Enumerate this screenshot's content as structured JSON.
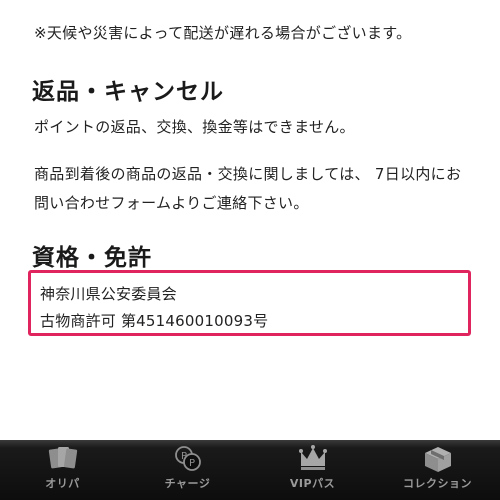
{
  "shipping_note": "※天候や災害によって配送が遅れる場合がございます。",
  "returns": {
    "heading": "返品・キャンセル",
    "paragraph1": "ポイントの返品、交換、換金等はできません。",
    "paragraph2": "商品到着後の商品の返品・交換に関しましては、 7日以内にお問い合わせフォームよりご連絡下さい。"
  },
  "license": {
    "heading": "資格・免許",
    "line1": "神奈川県公安委員会",
    "line2": "古物商許可 第451460010093号",
    "highlight_color": "#e0245e"
  },
  "bottom_nav": {
    "items": [
      {
        "label": "オリパ",
        "icon": "cards-icon"
      },
      {
        "label": "チャージ",
        "icon": "points-icon"
      },
      {
        "label": "VIPパス",
        "icon": "crown-icon"
      },
      {
        "label": "コレクション",
        "icon": "box-icon"
      }
    ],
    "text_color": "#9a9a9a"
  }
}
